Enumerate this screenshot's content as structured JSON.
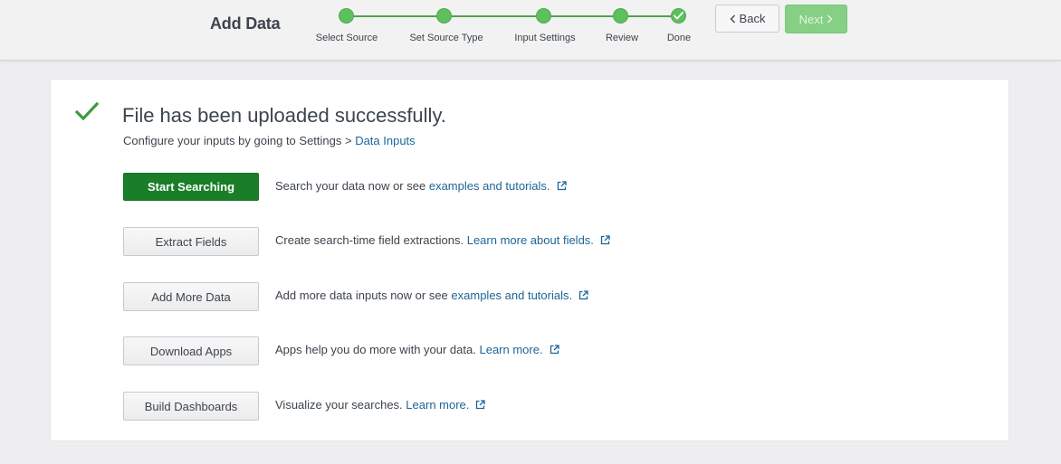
{
  "header": {
    "title": "Add Data",
    "steps": [
      {
        "label": "Select Source",
        "done": false
      },
      {
        "label": "Set Source Type",
        "done": false
      },
      {
        "label": "Input Settings",
        "done": false
      },
      {
        "label": "Review",
        "done": false
      },
      {
        "label": "Done",
        "done": true
      }
    ],
    "back_label": "Back",
    "next_label": "Next"
  },
  "success": {
    "title": "File has been uploaded successfully.",
    "subtitle_prefix": "Configure your inputs by going to Settings > ",
    "subtitle_link": "Data Inputs"
  },
  "actions": [
    {
      "button": "Start Searching",
      "primary": true,
      "desc": "Search your data now or see ",
      "link": "examples and tutorials."
    },
    {
      "button": "Extract Fields",
      "primary": false,
      "desc": "Create search-time field extractions. ",
      "link": "Learn more about fields."
    },
    {
      "button": "Add More Data",
      "primary": false,
      "desc": "Add more data inputs now or see ",
      "link": "examples and tutorials."
    },
    {
      "button": "Download Apps",
      "primary": false,
      "desc": "Apps help you do more with your data. ",
      "link": "Learn more."
    },
    {
      "button": "Build Dashboards",
      "primary": false,
      "desc": "Visualize your searches. ",
      "link": "Learn more."
    }
  ],
  "colors": {
    "accent_green": "#5cc05c",
    "primary_button": "#1a7e28",
    "link": "#1e6598",
    "next_disabled": "#85d085"
  },
  "icons": {
    "success": "checkmark-icon",
    "external": "external-link-icon",
    "back": "chevron-left-icon",
    "next": "chevron-right-icon"
  }
}
